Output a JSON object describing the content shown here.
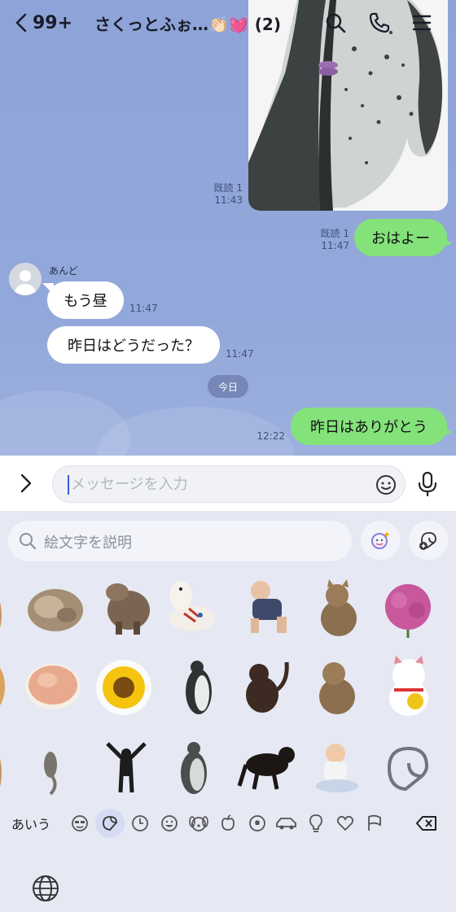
{
  "header": {
    "back_count": "99+",
    "title": "さくっとふぉ…👏🏻💓 (2)",
    "icons": [
      "back-chevron-icon",
      "search-icon",
      "phone-icon",
      "menu-icon"
    ]
  },
  "messages": [
    {
      "type": "image",
      "sender": "me",
      "read": "既読 1",
      "time": "11:43",
      "description": "penguin photo"
    },
    {
      "type": "text",
      "sender": "me",
      "read": "既読 1",
      "time": "11:47",
      "text": "おはよー"
    },
    {
      "type": "text",
      "sender": "あんど",
      "time": "11:47",
      "text": "もう昼"
    },
    {
      "type": "text",
      "sender": "あんど",
      "time": "11:47",
      "text": "昨日はどうだった？"
    },
    {
      "type": "text",
      "sender": "me",
      "time": "12:22",
      "text": "昨日はありがとう"
    }
  ],
  "sender_name": "あんど",
  "date_separator": "今日",
  "input": {
    "placeholder": "メッセージを入力",
    "value": ""
  },
  "sticker_panel": {
    "search_placeholder": "絵文字を説明",
    "keyboard_label": "あいう",
    "categories": [
      "face-icon",
      "sticker-icon",
      "clock-icon",
      "smiley-icon",
      "dog-icon",
      "apple-icon",
      "soccer-icon",
      "car-icon",
      "bulb-icon",
      "heart-icon",
      "flag-icon"
    ],
    "selected_category": "sticker-icon"
  },
  "colors": {
    "chat_bg": "#8ea3d8",
    "my_bubble": "#84e27a",
    "their_bubble": "#ffffff",
    "panel_bg": "#e6e8f3",
    "date_chip": "#7686b6"
  }
}
